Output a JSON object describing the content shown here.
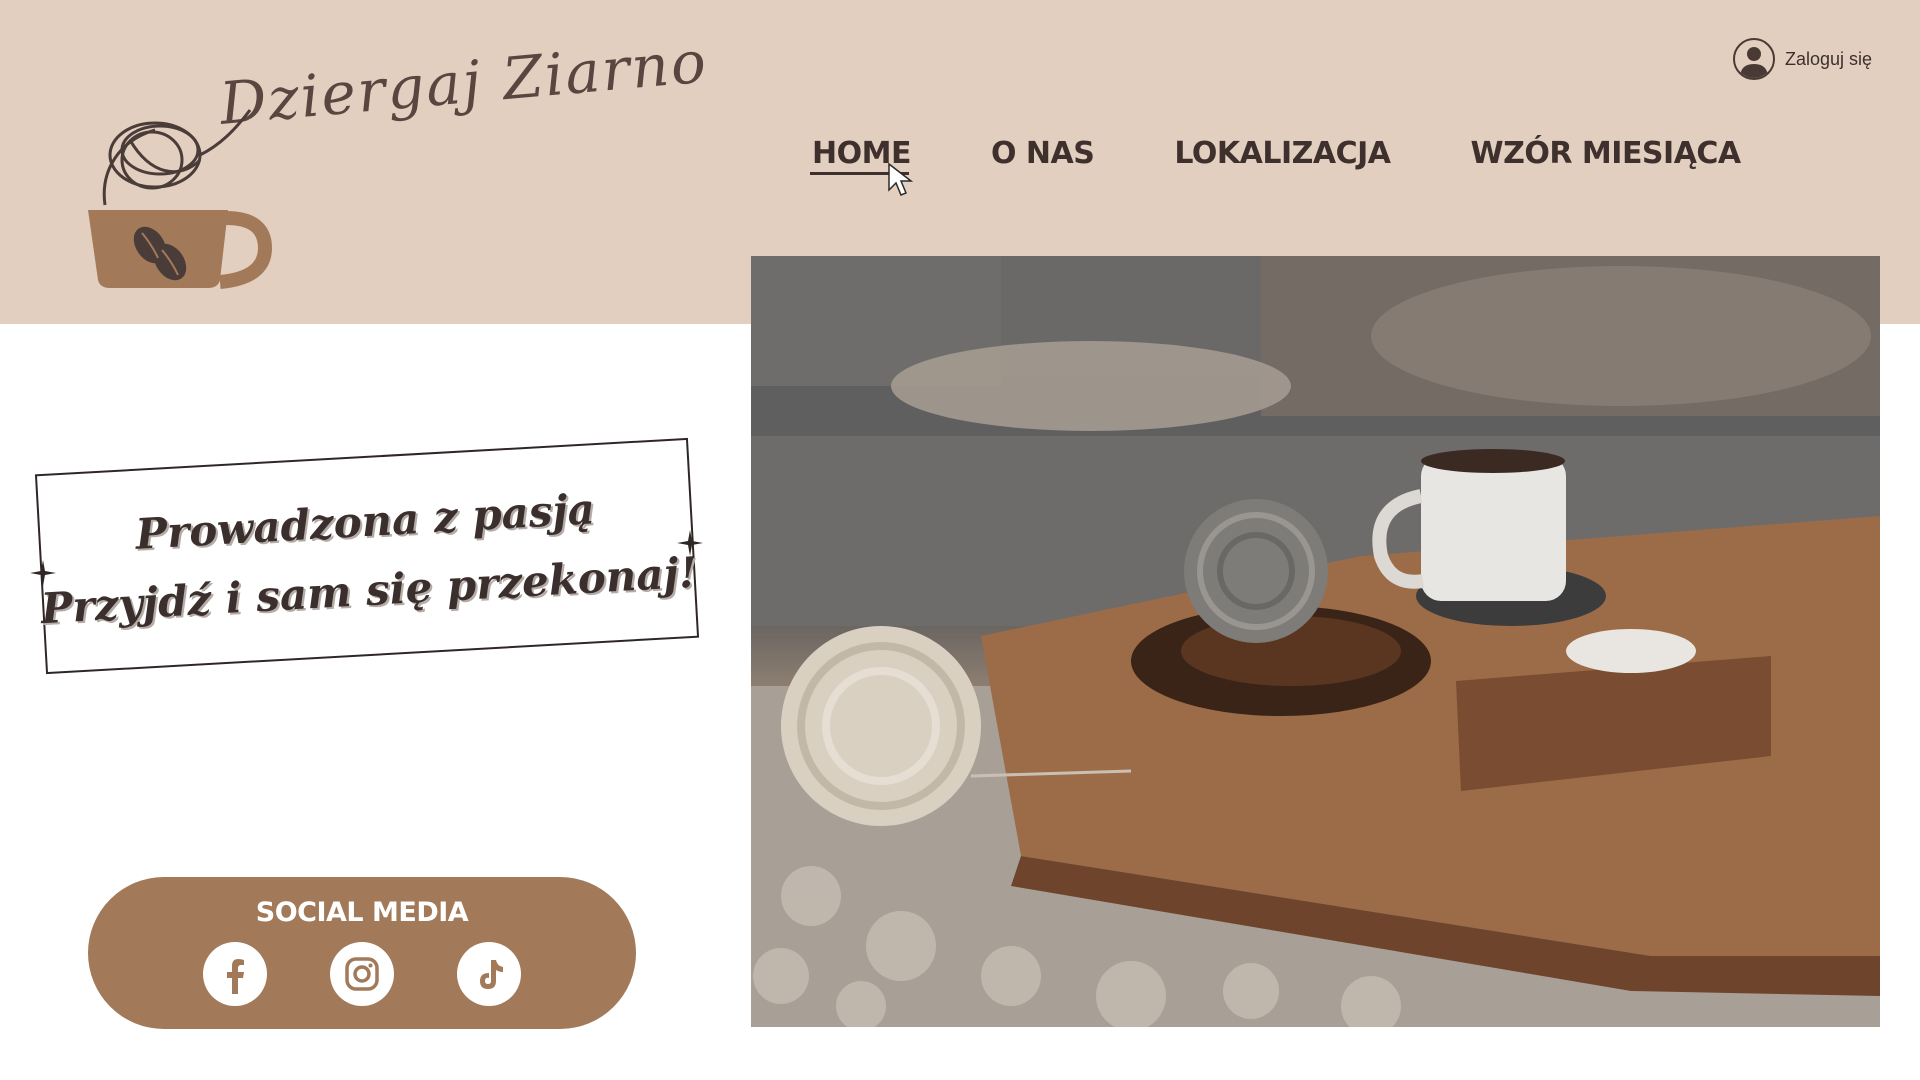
{
  "brand": {
    "name": "Dziergaj Ziarno"
  },
  "login": {
    "label": "Zaloguj się",
    "icon": "user-icon"
  },
  "nav": {
    "items": [
      {
        "label": "HOME",
        "active": true
      },
      {
        "label": "O NAS",
        "active": false
      },
      {
        "label": "LOKALIZACJA",
        "active": false
      },
      {
        "label": "WZÓR MIESIĄCA",
        "active": false
      }
    ]
  },
  "quote": {
    "line1": "Prowadzona z pasją",
    "line2": "Przyjdź i sam się przekonaj!"
  },
  "social": {
    "title": "SOCIAL MEDIA",
    "icons": [
      "facebook-icon",
      "instagram-icon",
      "tiktok-icon"
    ]
  },
  "colors": {
    "header_bg": "#e3cfbf",
    "social_bg": "#a27a5a",
    "text_dark": "#3e302c"
  }
}
